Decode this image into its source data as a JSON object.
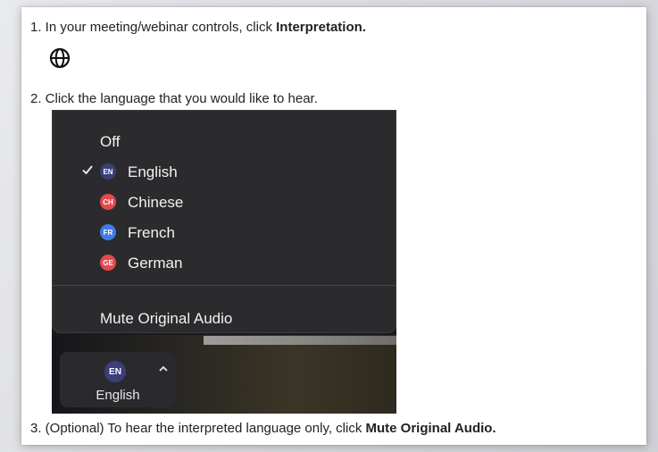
{
  "steps": {
    "step1": {
      "prefix": "1. In your meeting/webinar controls, click ",
      "bold": "Interpretation."
    },
    "step2": {
      "text": "2. Click the language that you would like to hear."
    },
    "step3": {
      "prefix": "3. (Optional) To hear the interpreted language only, click ",
      "bold": "Mute Original Audio."
    }
  },
  "icons": {
    "interpretation": "globe-icon",
    "selected": "checkmark-icon",
    "expand": "caret-up-icon"
  },
  "menu": {
    "off_label": "Off",
    "languages": [
      {
        "code": "EN",
        "label": "English",
        "color": "#3b3f78",
        "selected": true
      },
      {
        "code": "CH",
        "label": "Chinese",
        "color": "#e5484d",
        "selected": false
      },
      {
        "code": "FR",
        "label": "French",
        "color": "#3d7be8",
        "selected": false
      },
      {
        "code": "GE",
        "label": "German",
        "color": "#e5484d",
        "selected": false
      }
    ],
    "mute_label": "Mute Original Audio"
  },
  "control": {
    "badge": "EN",
    "label": "English"
  },
  "colors": {
    "menu_bg": "#2b2b2e",
    "text_light": "#f2f2f2"
  }
}
